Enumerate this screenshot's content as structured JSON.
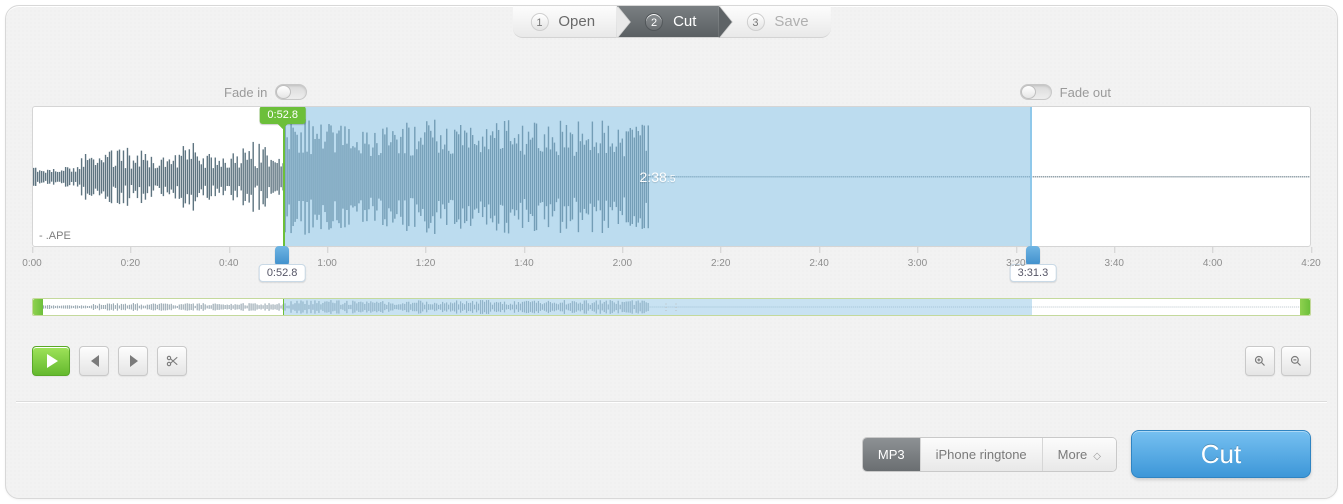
{
  "steps": [
    {
      "num": "1",
      "label": "Open"
    },
    {
      "num": "2",
      "label": "Cut"
    },
    {
      "num": "3",
      "label": "Save"
    }
  ],
  "fade": {
    "in_label": "Fade in",
    "out_label": "Fade out",
    "in_on": false,
    "out_on": false
  },
  "file": {
    "ext": "- .APE"
  },
  "selection": {
    "start_label": "0:52.8",
    "end_label": "3:31.3",
    "duration_main": "2:38",
    "duration_sub": ".5",
    "start_seconds": 52.8,
    "end_seconds": 211.3,
    "total_seconds": 270
  },
  "ticks": [
    "0:00",
    "0:20",
    "0:40",
    "1:00",
    "1:20",
    "1:40",
    "2:00",
    "2:20",
    "2:40",
    "3:00",
    "3:20",
    "3:40",
    "4:00",
    "4:20"
  ],
  "formats": {
    "active": "MP3",
    "alt1": "iPhone ringtone",
    "more": "More"
  },
  "cut_button": "Cut"
}
